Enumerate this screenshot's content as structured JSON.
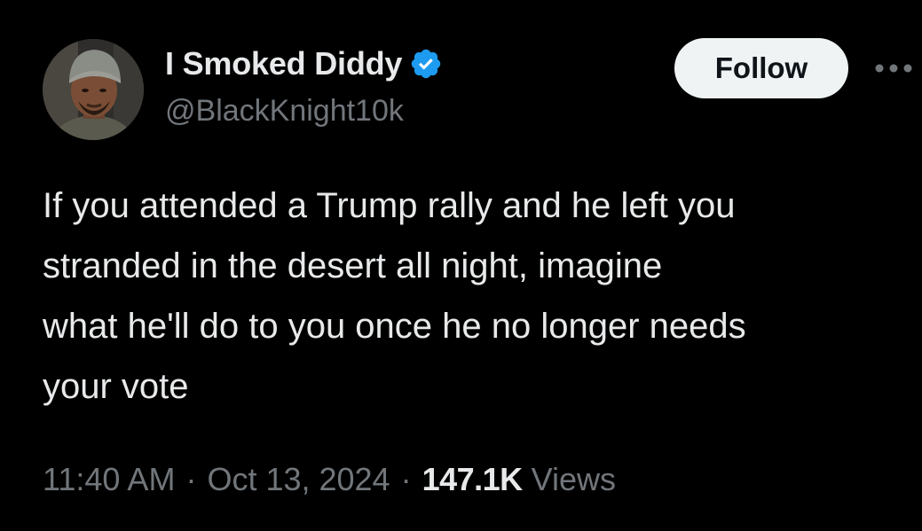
{
  "user": {
    "display_name": "I Smoked Diddy",
    "handle": "@BlackKnight10k",
    "verified": true,
    "verified_color": "#1d9bf0",
    "avatar_icon": "profile-photo"
  },
  "actions": {
    "follow_label": "Follow",
    "more_icon": "more-dots-icon"
  },
  "tweet": {
    "text": "If you attended a Trump rally and he left you\nstranded in the desert all night, imagine\nwhat he'll do to you once he no longer needs\nyour vote"
  },
  "meta": {
    "time": "11:40 AM",
    "separator": "·",
    "date": "Oct 13, 2024",
    "views_count": "147.1K",
    "views_label": "Views"
  }
}
